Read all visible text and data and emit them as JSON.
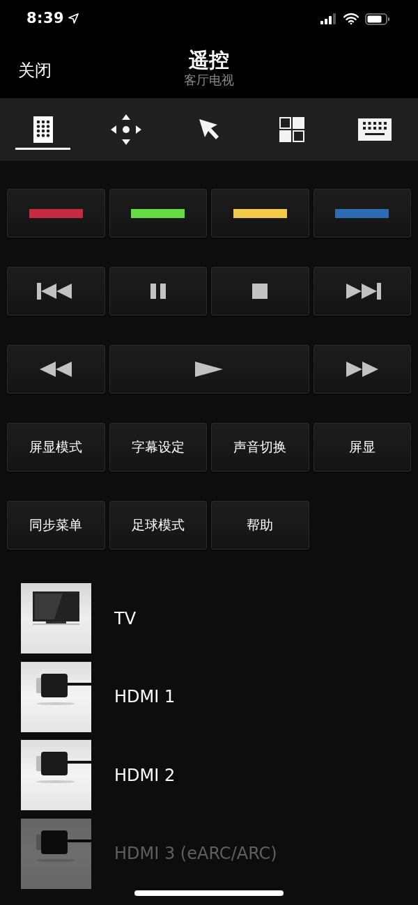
{
  "status_bar": {
    "time": "8:39"
  },
  "nav": {
    "close": "关闭",
    "title": "遥控",
    "subtitle": "客厅电视"
  },
  "tabs": [
    {
      "kind": "remote",
      "selected": true
    },
    {
      "kind": "dpad",
      "selected": false
    },
    {
      "kind": "pointer",
      "selected": false
    },
    {
      "kind": "apps",
      "selected": false
    },
    {
      "kind": "keyboard",
      "selected": false
    }
  ],
  "button_rows": [
    [
      {
        "kind": "color",
        "color": "#c62a3e"
      },
      {
        "kind": "color",
        "color": "#66dd44"
      },
      {
        "kind": "color",
        "color": "#f2c94a"
      },
      {
        "kind": "color",
        "color": "#2e6bb5"
      }
    ],
    [
      {
        "kind": "previous"
      },
      {
        "kind": "pause"
      },
      {
        "kind": "stop"
      },
      {
        "kind": "next"
      }
    ],
    [
      {
        "kind": "rewind"
      },
      {
        "kind": "play",
        "wide": true
      },
      {
        "kind": "fast-forward"
      }
    ],
    [
      {
        "kind": "text",
        "label": "屏显模式"
      },
      {
        "kind": "text",
        "label": "字幕设定"
      },
      {
        "kind": "text",
        "label": "声音切换"
      },
      {
        "kind": "text",
        "label": "屏显"
      }
    ],
    [
      {
        "kind": "text",
        "label": "同步菜单"
      },
      {
        "kind": "text",
        "label": "足球模式"
      },
      {
        "kind": "text",
        "label": "帮助"
      }
    ]
  ],
  "inputs": [
    {
      "kind": "tv",
      "label": "TV",
      "dimmed": false
    },
    {
      "kind": "hdmi",
      "label": "HDMI 1",
      "dimmed": false
    },
    {
      "kind": "hdmi",
      "label": "HDMI 2",
      "dimmed": false
    },
    {
      "kind": "hdmi",
      "label": "HDMI 3 (eARC/ARC)",
      "dimmed": true
    }
  ]
}
